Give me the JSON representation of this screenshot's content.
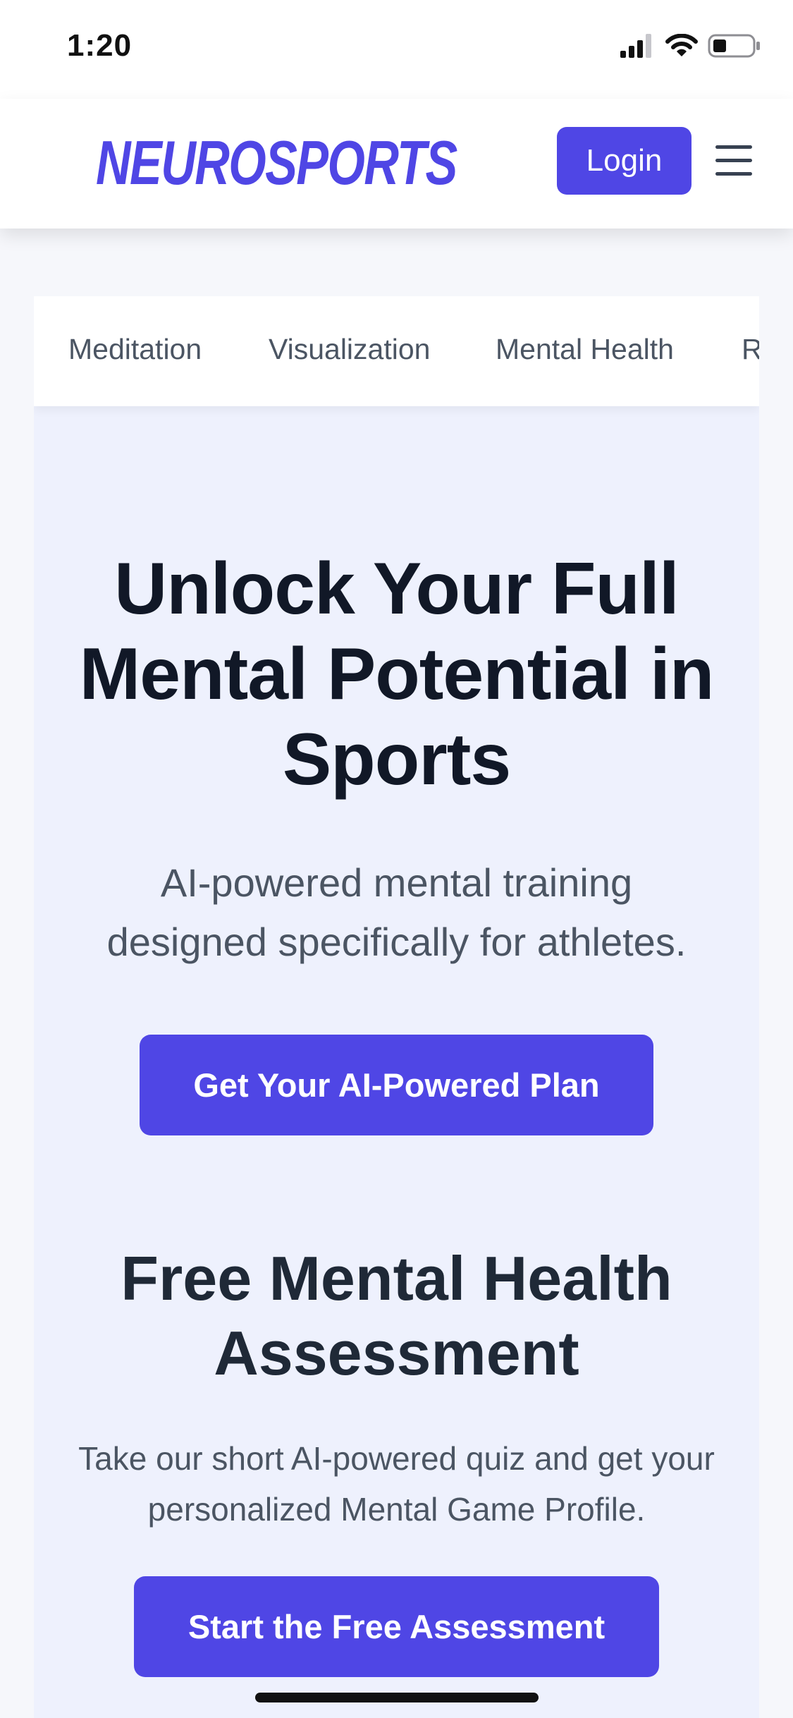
{
  "status_bar": {
    "time": "1:20",
    "icons": [
      "cellular-signal-icon",
      "wifi-icon",
      "battery-icon"
    ]
  },
  "header": {
    "logo": "NEUROSPORTS",
    "login_label": "Login",
    "menu_icon": "hamburger-menu-icon"
  },
  "tabs": [
    {
      "label": "Meditation"
    },
    {
      "label": "Visualization"
    },
    {
      "label": "Mental Health"
    },
    {
      "label": "R"
    }
  ],
  "hero": {
    "title": "Unlock Your Full Mental Potential in Sports",
    "subtitle": "AI-powered mental training designed specifically for athletes.",
    "cta_label": "Get Your AI-Powered Plan"
  },
  "assessment": {
    "title": "Free Mental Health Assessment",
    "description": "Take our short AI-powered quiz and get your personalized Mental Game Profile.",
    "cta_label": "Start the Free Assessment"
  },
  "colors": {
    "brand": "#4f46e5",
    "heading": "#111827",
    "body_text": "#4b5563",
    "card_background": "#eef1fd"
  }
}
